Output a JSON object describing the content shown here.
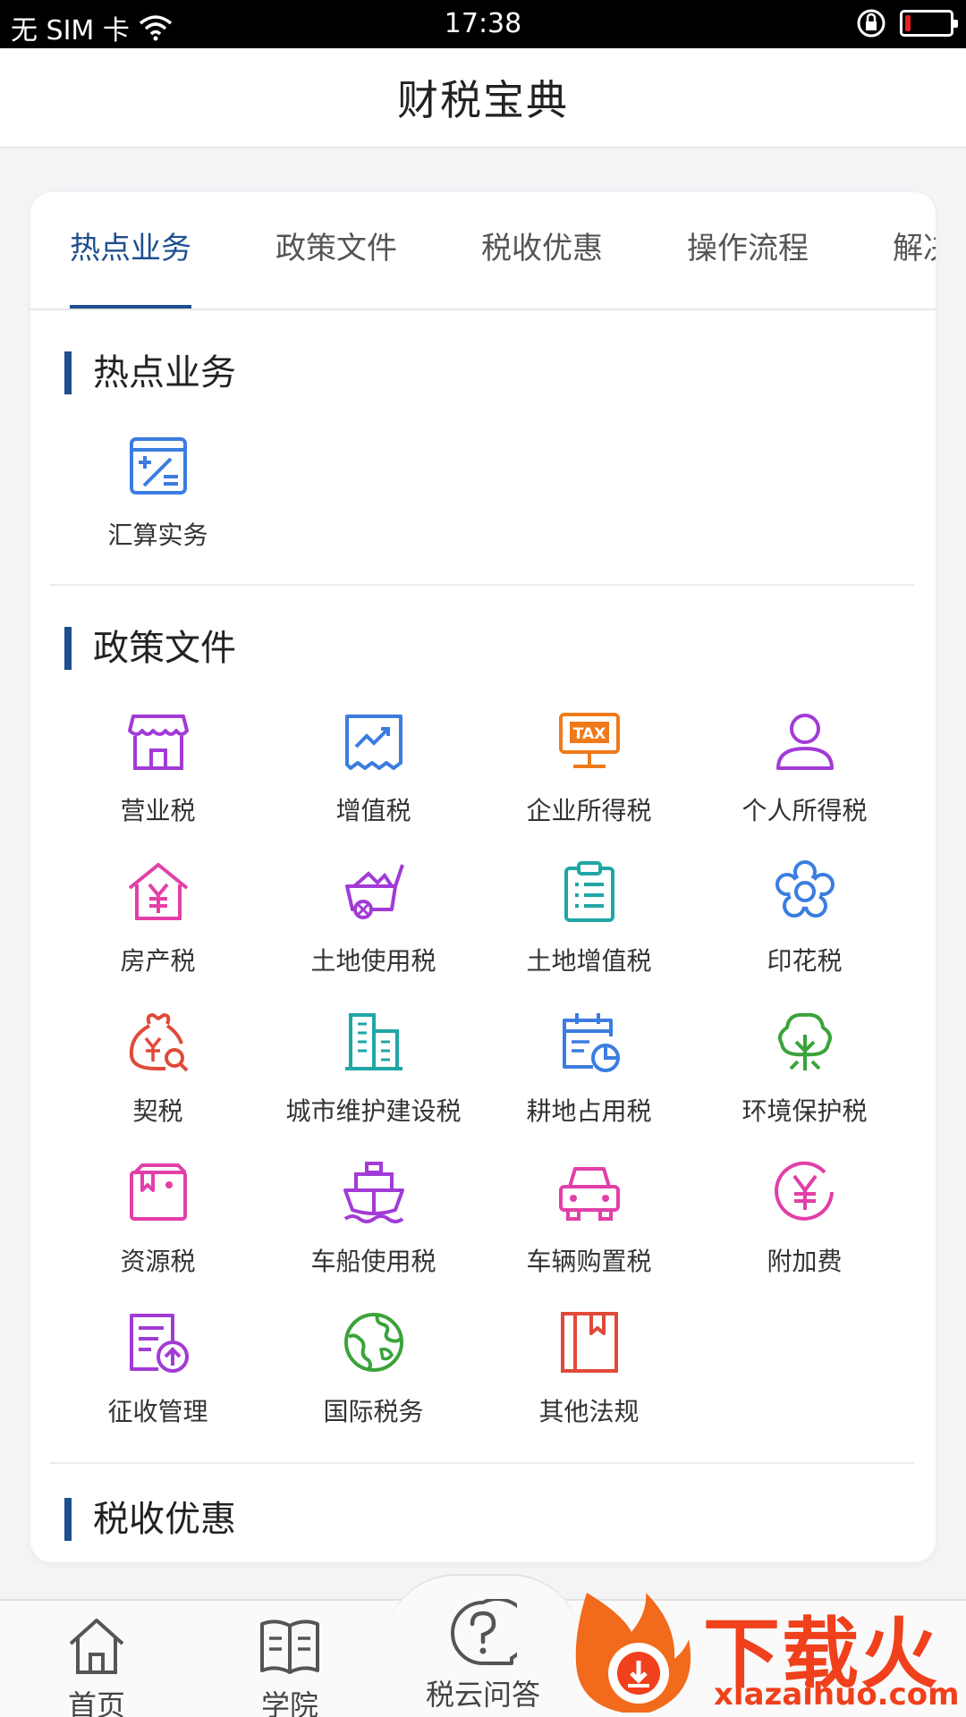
{
  "status": {
    "carrier": "无 SIM 卡",
    "time": "17:38",
    "battery_level_pct": 12
  },
  "header": {
    "title": "财税宝典"
  },
  "tabs": [
    {
      "label": "热点业务",
      "active": true
    },
    {
      "label": "政策文件",
      "active": false
    },
    {
      "label": "税收优惠",
      "active": false
    },
    {
      "label": "操作流程",
      "active": false
    },
    {
      "label": "解决",
      "active": false
    }
  ],
  "sections": {
    "hot": {
      "title": "热点业务",
      "items": [
        {
          "label": "汇算实务",
          "icon": "calculator-icon"
        }
      ]
    },
    "policy": {
      "title": "政策文件",
      "items": [
        {
          "label": "营业税",
          "icon": "store-icon"
        },
        {
          "label": "增值税",
          "icon": "trend-chart-icon"
        },
        {
          "label": "企业所得税",
          "icon": "tax-board-icon"
        },
        {
          "label": "个人所得税",
          "icon": "person-icon"
        },
        {
          "label": "房产税",
          "icon": "house-yen-icon"
        },
        {
          "label": "土地使用税",
          "icon": "cart-icon"
        },
        {
          "label": "土地增值税",
          "icon": "clipboard-icon"
        },
        {
          "label": "印花税",
          "icon": "flower-icon"
        },
        {
          "label": "契税",
          "icon": "money-bag-icon"
        },
        {
          "label": "城市维护建设税",
          "icon": "building-icon"
        },
        {
          "label": "耕地占用税",
          "icon": "calendar-chart-icon"
        },
        {
          "label": "环境保护税",
          "icon": "tree-icon"
        },
        {
          "label": "资源税",
          "icon": "resource-box-icon"
        },
        {
          "label": "车船使用税",
          "icon": "ship-icon"
        },
        {
          "label": "车辆购置税",
          "icon": "car-icon"
        },
        {
          "label": "附加费",
          "icon": "yen-circle-icon"
        },
        {
          "label": "征收管理",
          "icon": "document-upload-icon"
        },
        {
          "label": "国际税务",
          "icon": "globe-icon"
        },
        {
          "label": "其他法规",
          "icon": "book-icon"
        }
      ]
    },
    "preferential": {
      "title": "税收优惠"
    }
  },
  "bottom_nav": [
    {
      "label": "首页",
      "icon": "home-icon"
    },
    {
      "label": "学院",
      "icon": "open-book-icon"
    },
    {
      "label": "税云问答",
      "icon": "question-bubble-icon"
    }
  ],
  "watermark": {
    "title": "下载火",
    "url": "xiazaihuo.com"
  },
  "colors": {
    "accent": "#1e4f8e",
    "purple": "#a23bd6",
    "blue": "#3b7de0",
    "orange": "#f07a1a",
    "pink": "#e23fa8",
    "teal": "#21a6a6",
    "red": "#e04a3a",
    "green": "#3aa33a"
  }
}
